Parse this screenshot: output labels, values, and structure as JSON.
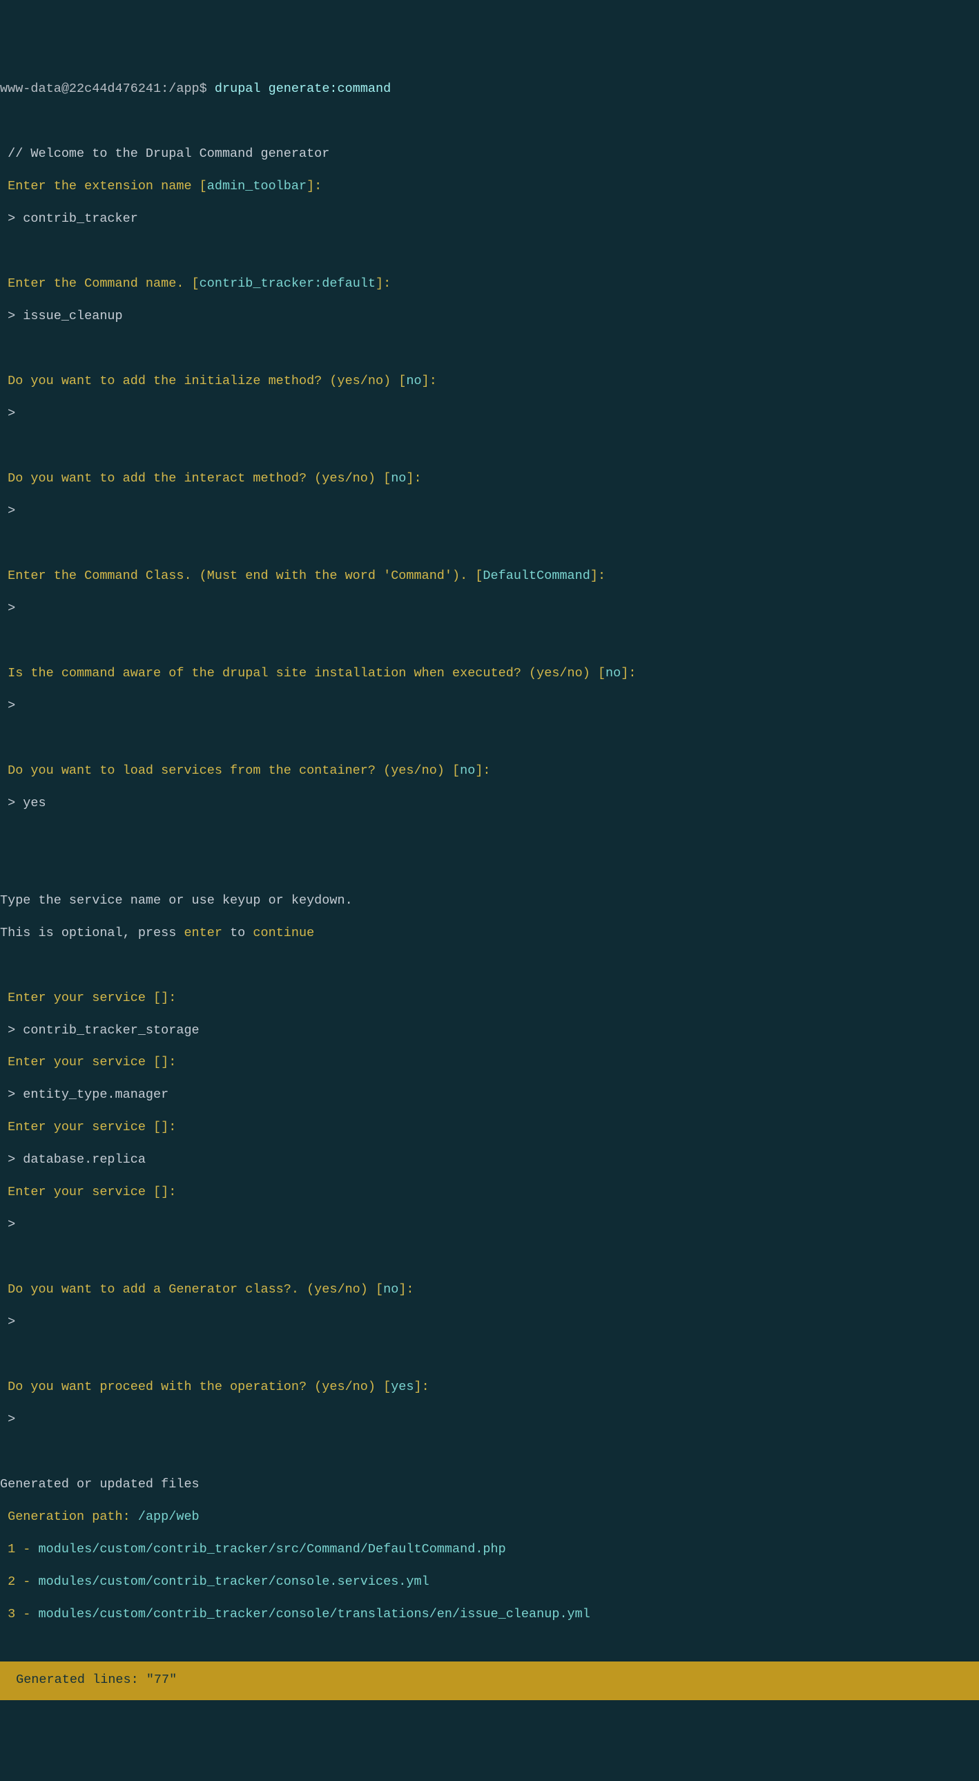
{
  "prompt": {
    "user_host": "www-data@22c44d476241",
    "cwd": "/app",
    "symbol": "$",
    "command": "drupal generate:command"
  },
  "l": {
    "welcome": " // Welcome to the Drupal Command generator",
    "ext_prompt_pre": " Enter the extension name [",
    "ext_default": "admin_toolbar",
    "ext_prompt_post": "]:",
    "ext_input": " > contrib_tracker",
    "cmd_prompt_pre": " Enter the Command name. [",
    "cmd_default": "contrib_tracker:default",
    "cmd_prompt_post": "]:",
    "cmd_input": " > issue_cleanup",
    "init_q_pre": " Do you want to add the initialize method? (yes/no) [",
    "init_def": "no",
    "init_q_post": "]:",
    "init_in": " >",
    "inter_q_pre": " Do you want to add the interact method? (yes/no) [",
    "inter_def": "no",
    "inter_q_post": "]:",
    "inter_in": " >",
    "class_q_pre": " Enter the Command Class. (Must end with the word 'Command'). [",
    "class_def": "DefaultCommand",
    "class_q_post": "]:",
    "class_in": " >",
    "aware_q_pre": " Is the command aware of the drupal site installation when executed? (yes/no) [",
    "aware_def": "no",
    "aware_q_post": "]:",
    "aware_in": " >",
    "svc_q_pre": " Do you want to load services from the container? (yes/no) [",
    "svc_def": "no",
    "svc_q_post": "]:",
    "svc_in": " > yes",
    "hint1": "Type the service name or use keyup or keydown.",
    "hint2_pre": "This is optional, press ",
    "hint2_enter": "enter",
    "hint2_mid": " to ",
    "hint2_cont": "continue",
    "es_pre": " Enter your service [",
    "es_post": "]:",
    "es1_in": " > contrib_tracker_storage",
    "es2_in": " > entity_type.manager",
    "es3_in": " > database.replica",
    "es4_in": " >",
    "gen_q_pre": " Do you want to add a Generator class?. (yes/no) [",
    "gen_def": "no",
    "gen_q_post": "]:",
    "gen_in": " >",
    "proc_q_pre": " Do you want proceed with the operation? (yes/no) [",
    "proc_def": "yes",
    "proc_q_post": "]:",
    "proc_in": " >",
    "files_header": "Generated or updated files",
    "path_label": " Generation path: ",
    "path_val": "/app/web",
    "f1_n": " 1 - ",
    "f1_p": "modules/custom/contrib_tracker/src/Command/DefaultCommand.php",
    "f2_n": " 2 - ",
    "f2_p": "modules/custom/contrib_tracker/console.services.yml",
    "f3_n": " 3 - ",
    "f3_p": "modules/custom/contrib_tracker/console/translations/en/issue_cleanup.yml",
    "footer": " Generated lines: \"77\""
  }
}
